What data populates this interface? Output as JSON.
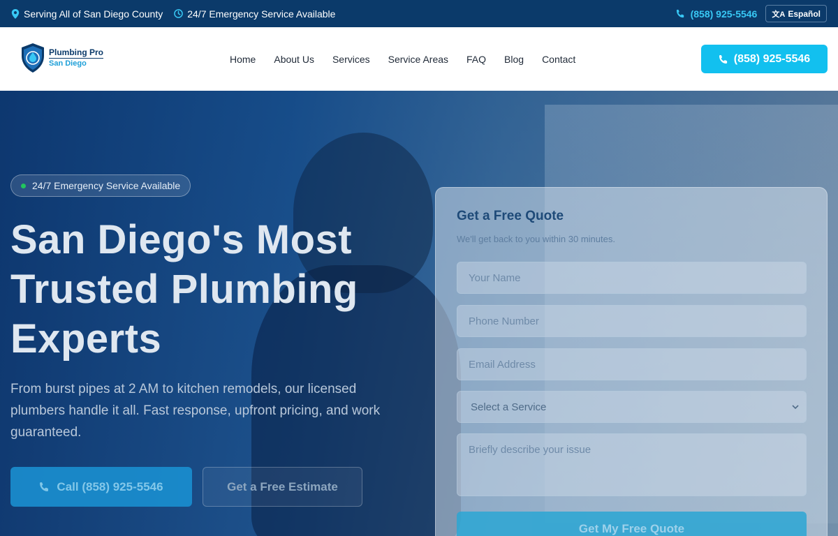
{
  "topbar": {
    "area_text": "Serving All of San Diego County",
    "emergency_text": "24/7 Emergency Service Available",
    "phone": "(858) 925-5546",
    "language_label": "Español",
    "language_glyph": "文A"
  },
  "header": {
    "logo_line1": "Plumbing Pro",
    "logo_line2": "San Diego",
    "nav": [
      "Home",
      "About Us",
      "Services",
      "Service Areas",
      "FAQ",
      "Blog",
      "Contact"
    ],
    "cta_phone": "(858) 925-5546"
  },
  "hero": {
    "badge": "24/7 Emergency Service Available",
    "title_line1": "San Diego's Most",
    "title_line2": "Trusted Plumbing",
    "title_line3": "Experts",
    "subtitle": "From burst pipes at 2 AM to kitchen remodels, our licensed plumbers handle it all. Fast response, upfront pricing, and work guaranteed.",
    "call_button": "Call (858) 925-5546",
    "estimate_button": "Get a Free Estimate"
  },
  "quote": {
    "title": "Get a Free Quote",
    "subtitle": "We'll get back to you within 30 minutes.",
    "name_placeholder": "Your Name",
    "phone_placeholder": "Phone Number",
    "email_placeholder": "Email Address",
    "service_selected": "Select a Service",
    "issue_placeholder": "Briefly describe your issue",
    "submit_label": "Get My Free Quote"
  },
  "colors": {
    "topbar_bg": "#0b3a6a",
    "accent": "#12c0ef",
    "navy": "#0b3a6a"
  },
  "icons": {
    "location": "map-pin-icon",
    "clock": "clock-icon",
    "phone": "phone-icon",
    "translate": "translate-icon",
    "chevron": "chevron-down-icon"
  }
}
